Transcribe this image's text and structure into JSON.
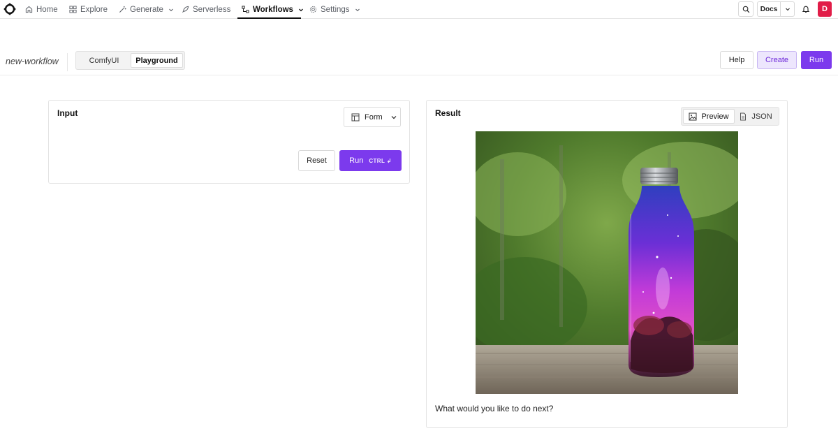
{
  "nav": {
    "logo": "logo-icon",
    "items": [
      {
        "label": "Home",
        "icon": "home-icon"
      },
      {
        "label": "Explore",
        "icon": "grid-icon"
      },
      {
        "label": "Generate",
        "icon": "wand-icon",
        "dropdown": true
      },
      {
        "label": "Serverless",
        "icon": "rocket-icon"
      },
      {
        "label": "Workflows",
        "icon": "workflow-icon",
        "dropdown": true,
        "active": true
      },
      {
        "label": "Settings",
        "icon": "gear-icon",
        "dropdown": true
      }
    ],
    "search_icon": "search-icon",
    "docs_label": "Docs",
    "notifications_icon": "bell-icon",
    "avatar_initial": "D",
    "avatar_color": "#e11d48"
  },
  "workflow": {
    "name": "new-workflow",
    "modes": [
      "ComfyUI",
      "Playground"
    ],
    "selected_mode": "Playground",
    "actions": {
      "help": "Help",
      "create": "Create",
      "run": "Run"
    }
  },
  "input_panel": {
    "title": "Input",
    "view_select": "Form",
    "reset_label": "Reset",
    "run_label": "Run",
    "run_shortcut": "CTRL ↲"
  },
  "result_panel": {
    "title": "Result",
    "tabs": [
      {
        "label": "Preview",
        "icon": "image-icon"
      },
      {
        "label": "JSON",
        "icon": "file-icon"
      }
    ],
    "selected_tab": "Preview",
    "image_subject": "galaxy bottle",
    "prompt_text": "What would you like to do next?"
  },
  "colors": {
    "accent": "#7c3aed",
    "accent_soft": "#ede6fd"
  }
}
